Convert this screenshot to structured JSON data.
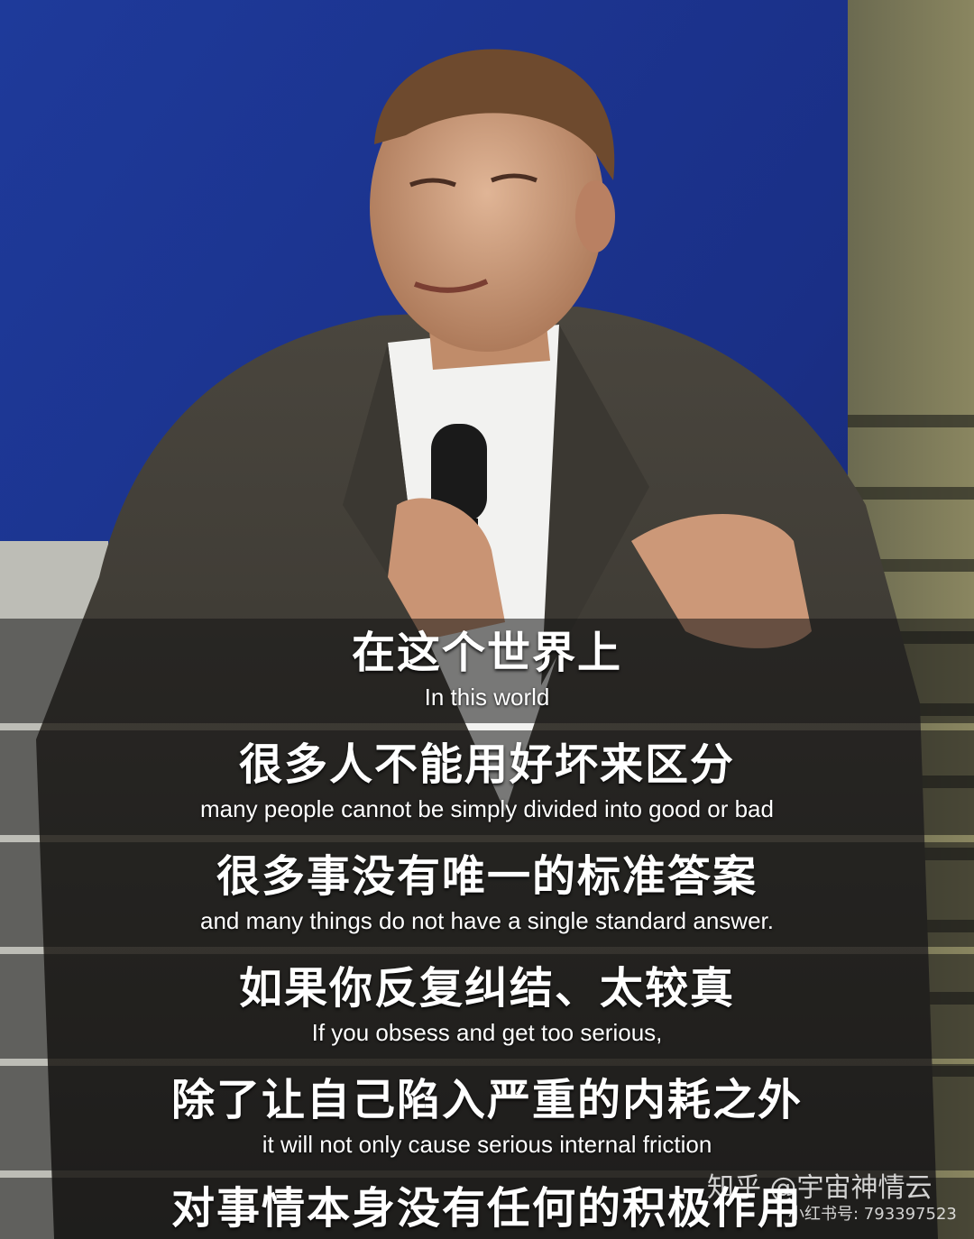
{
  "subtitles": [
    {
      "zh": "在这个世界上",
      "en": "In this world"
    },
    {
      "zh": "很多人不能用好坏来区分",
      "en": "many people cannot be simply divided into good or bad"
    },
    {
      "zh": "很多事没有唯一的标准答案",
      "en": "and many things do not have a single standard answer."
    },
    {
      "zh": "如果你反复纠结、太较真",
      "en": "If you obsess and get too serious,"
    },
    {
      "zh": "除了让自己陷入严重的内耗之外",
      "en": "it will not only cause serious internal friction"
    },
    {
      "zh": "对事情本身没有任何的积极作用",
      "en": ""
    }
  ],
  "watermark": {
    "brand": "知乎 @宇宙神情云",
    "handle": "小红书号: 793397523"
  }
}
